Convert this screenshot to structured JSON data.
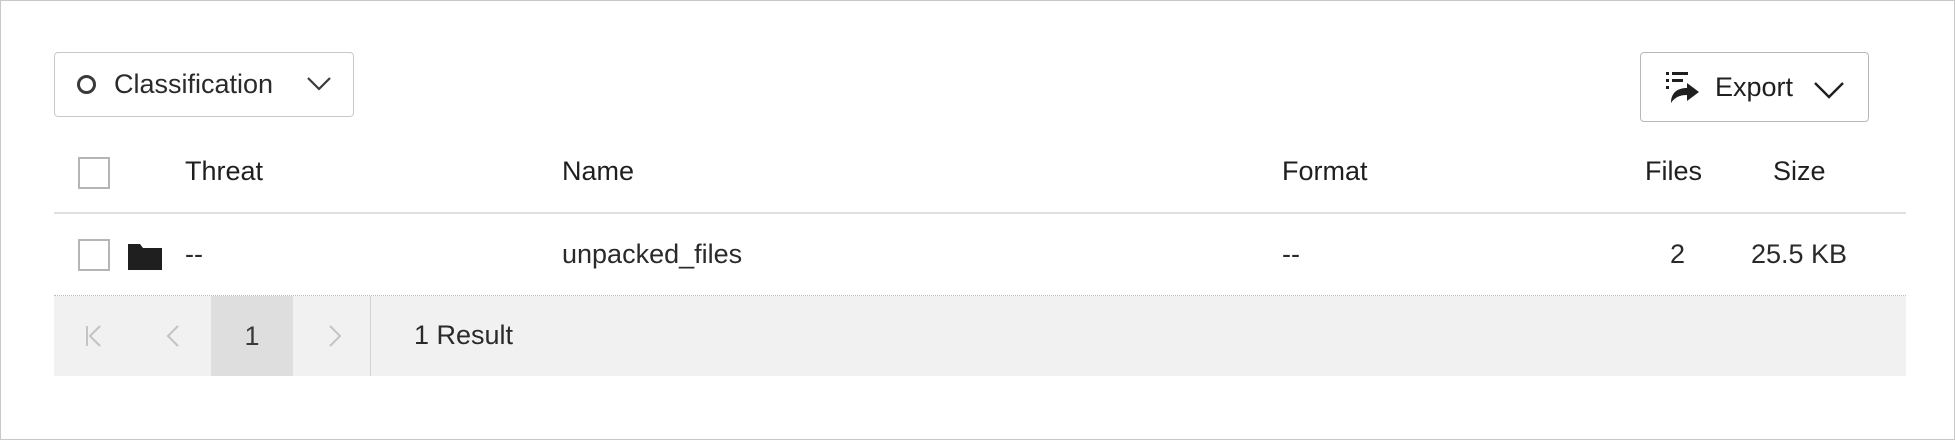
{
  "toolbar": {
    "classification_label": "Classification",
    "export_label": "Export"
  },
  "table": {
    "headers": {
      "threat": "Threat",
      "name": "Name",
      "format": "Format",
      "files": "Files",
      "size": "Size"
    },
    "rows": [
      {
        "icon": "folder-icon",
        "threat": "--",
        "name": "unpacked_files",
        "format": "--",
        "files": "2",
        "size": "25.5 KB"
      }
    ]
  },
  "pager": {
    "current_page": "1",
    "result_text": "1 Result"
  },
  "colors": {
    "border": "#c9c9c9",
    "pager_bg": "#f1f1f1",
    "active_page_bg": "#dedede",
    "text": "#1f1f1f"
  }
}
